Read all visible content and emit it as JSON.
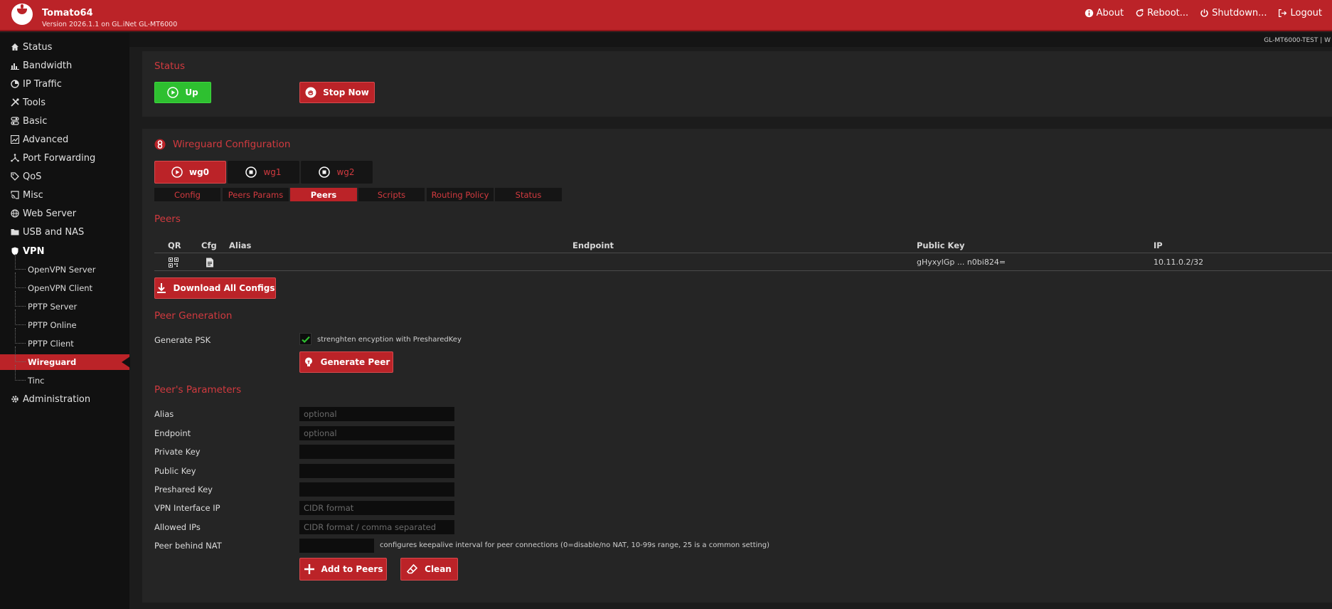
{
  "header": {
    "brand": "Tomato64",
    "version": "Version 2026.1.1 on GL.iNet GL-MT6000",
    "nav": [
      {
        "label": "About",
        "icon": "info-icon"
      },
      {
        "label": "Reboot...",
        "icon": "reboot-icon"
      },
      {
        "label": "Shutdown...",
        "icon": "power-icon"
      },
      {
        "label": "Logout",
        "icon": "logout-icon"
      }
    ]
  },
  "hostname": "GL-MT6000-TEST | W",
  "sidebar": {
    "items": [
      {
        "label": "Status",
        "icon": "home-icon"
      },
      {
        "label": "Bandwidth",
        "icon": "bar-chart-icon"
      },
      {
        "label": "IP Traffic",
        "icon": "pie-icon"
      },
      {
        "label": "Tools",
        "icon": "tools-icon"
      },
      {
        "label": "Basic",
        "icon": "toggle-icon"
      },
      {
        "label": "Advanced",
        "icon": "chart-icon"
      },
      {
        "label": "Port Forwarding",
        "icon": "network-icon"
      },
      {
        "label": "QoS",
        "icon": "tag-icon"
      },
      {
        "label": "Misc",
        "icon": "cast-icon"
      },
      {
        "label": "Web Server",
        "icon": "globe-icon"
      },
      {
        "label": "USB and NAS",
        "icon": "folder-icon"
      },
      {
        "label": "VPN",
        "icon": "shield-icon"
      }
    ],
    "vpn_items": [
      {
        "label": "OpenVPN Server"
      },
      {
        "label": "OpenVPN Client"
      },
      {
        "label": "PPTP Server"
      },
      {
        "label": "PPTP Online"
      },
      {
        "label": "PPTP Client"
      },
      {
        "label": "Wireguard"
      },
      {
        "label": "Tinc"
      }
    ],
    "admin": {
      "label": "Administration",
      "icon": "gear-icon"
    }
  },
  "status_section": {
    "title": "Status",
    "up_label": "Up",
    "stop_label": "Stop Now"
  },
  "wg_section": {
    "title": "Wireguard Configuration",
    "interfaces": [
      "wg0",
      "wg1",
      "wg2"
    ],
    "tabs": [
      "Config",
      "Peers Params",
      "Peers",
      "Scripts",
      "Routing Policy",
      "Status"
    ],
    "peers_title": "Peers",
    "table": {
      "headers": [
        "QR",
        "Cfg",
        "Alias",
        "Endpoint",
        "Public Key",
        "IP"
      ],
      "rows": [
        {
          "alias": "",
          "endpoint": "",
          "public_key": "gHyxylGp ... n0bi824=",
          "ip": "10.11.0.2/32"
        }
      ]
    },
    "download_all_label": "Download All Configs",
    "peer_gen": {
      "title": "Peer Generation",
      "psk_label": "Generate PSK",
      "psk_hint": "strenghten encyption with PresharedKey",
      "generate_label": "Generate Peer"
    },
    "params": {
      "title": "Peer's Parameters",
      "alias_label": "Alias",
      "alias_placeholder": "optional",
      "endpoint_label": "Endpoint",
      "endpoint_placeholder": "optional",
      "private_key_label": "Private Key",
      "public_key_label": "Public Key",
      "preshared_key_label": "Preshared Key",
      "vpn_ip_label": "VPN Interface IP",
      "vpn_ip_placeholder": "CIDR format",
      "allowed_ips_label": "Allowed IPs",
      "allowed_ips_placeholder": "CIDR format / comma separated",
      "nat_label": "Peer behind NAT",
      "nat_hint": "configures keepalive interval for peer connections (0=disable/no NAT, 10-99s range, 25 is a common setting)",
      "add_label": "Add to Peers",
      "clean_label": "Clean"
    }
  },
  "colors": {
    "accent": "#bb2328",
    "accent_text": "#d23a3f",
    "success": "#2ec030",
    "panel": "#252525",
    "sidebar": "#111111"
  }
}
